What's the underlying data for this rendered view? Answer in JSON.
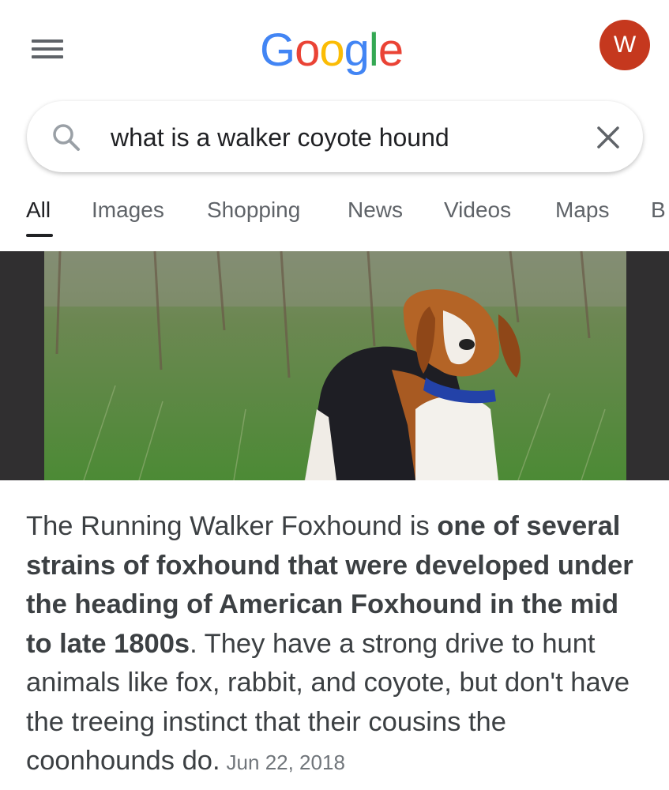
{
  "header": {
    "logo_letters": [
      "G",
      "o",
      "o",
      "g",
      "l",
      "e"
    ],
    "logo_colors": [
      "#4285F4",
      "#EA4335",
      "#FBBC05",
      "#4285F4",
      "#34A853",
      "#EA4335"
    ],
    "avatar_letter": "W",
    "avatar_color": "#c5381e"
  },
  "search": {
    "query": "what is a walker coyote hound"
  },
  "tabs": [
    {
      "label": "All",
      "active": true
    },
    {
      "label": "Images",
      "active": false
    },
    {
      "label": "Shopping",
      "active": false
    },
    {
      "label": "News",
      "active": false
    },
    {
      "label": "Videos",
      "active": false
    },
    {
      "label": "Maps",
      "active": false
    },
    {
      "label": "B",
      "active": false
    }
  ],
  "result": {
    "image_subject": "Running Walker Foxhound in grass with blue collar",
    "snippet_intro": "The Running Walker Foxhound is ",
    "snippet_bold": "one of several strains of foxhound that were developed under the heading of American Foxhound in the mid to late 1800s",
    "snippet_rest": ". They have a strong drive to hunt animals like fox, rabbit, and coyote, but don't have the treeing instinct that their cousins the coonhounds do.",
    "date": "Jun 22, 2018"
  }
}
